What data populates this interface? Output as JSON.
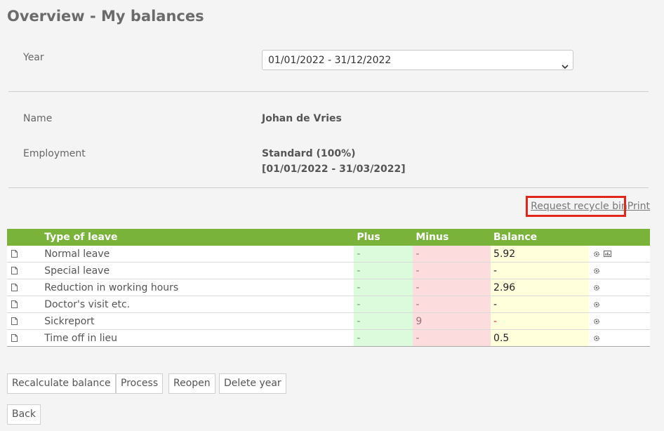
{
  "page": {
    "title": "Overview - My balances"
  },
  "year": {
    "label": "Year",
    "selected": "01/01/2022 - 31/12/2022"
  },
  "person": {
    "name_label": "Name",
    "name_value": "Johan de Vries",
    "employment_label": "Employment",
    "employment_value": "Standard (100%)",
    "employment_period": "[01/01/2022 - 31/03/2022]"
  },
  "links": {
    "recycle_bin": "Request recycle bin",
    "print": "Print"
  },
  "table": {
    "headers": {
      "type": "Type of leave",
      "plus": "Plus",
      "minus": "Minus",
      "balance": "Balance"
    },
    "rows": [
      {
        "type": "Normal leave",
        "plus": "-",
        "minus": "-",
        "balance": "5.92",
        "chart": true
      },
      {
        "type": "Special leave",
        "plus": "-",
        "minus": "-",
        "balance": "-"
      },
      {
        "type": "Reduction in working hours",
        "plus": "-",
        "minus": "-",
        "balance": "2.96"
      },
      {
        "type": "Doctor's visit etc.",
        "plus": "-",
        "minus": "-",
        "balance": "-"
      },
      {
        "type": "Sickreport",
        "plus": "-",
        "minus": "9",
        "balance": "-",
        "negative": true
      },
      {
        "type": "Time off in lieu",
        "plus": "-",
        "minus": "-",
        "balance": "0.5"
      }
    ]
  },
  "buttons": {
    "recalculate": "Recalculate balance",
    "process": "Process",
    "reopen": "Reopen",
    "delete_year": "Delete year",
    "back": "Back"
  }
}
